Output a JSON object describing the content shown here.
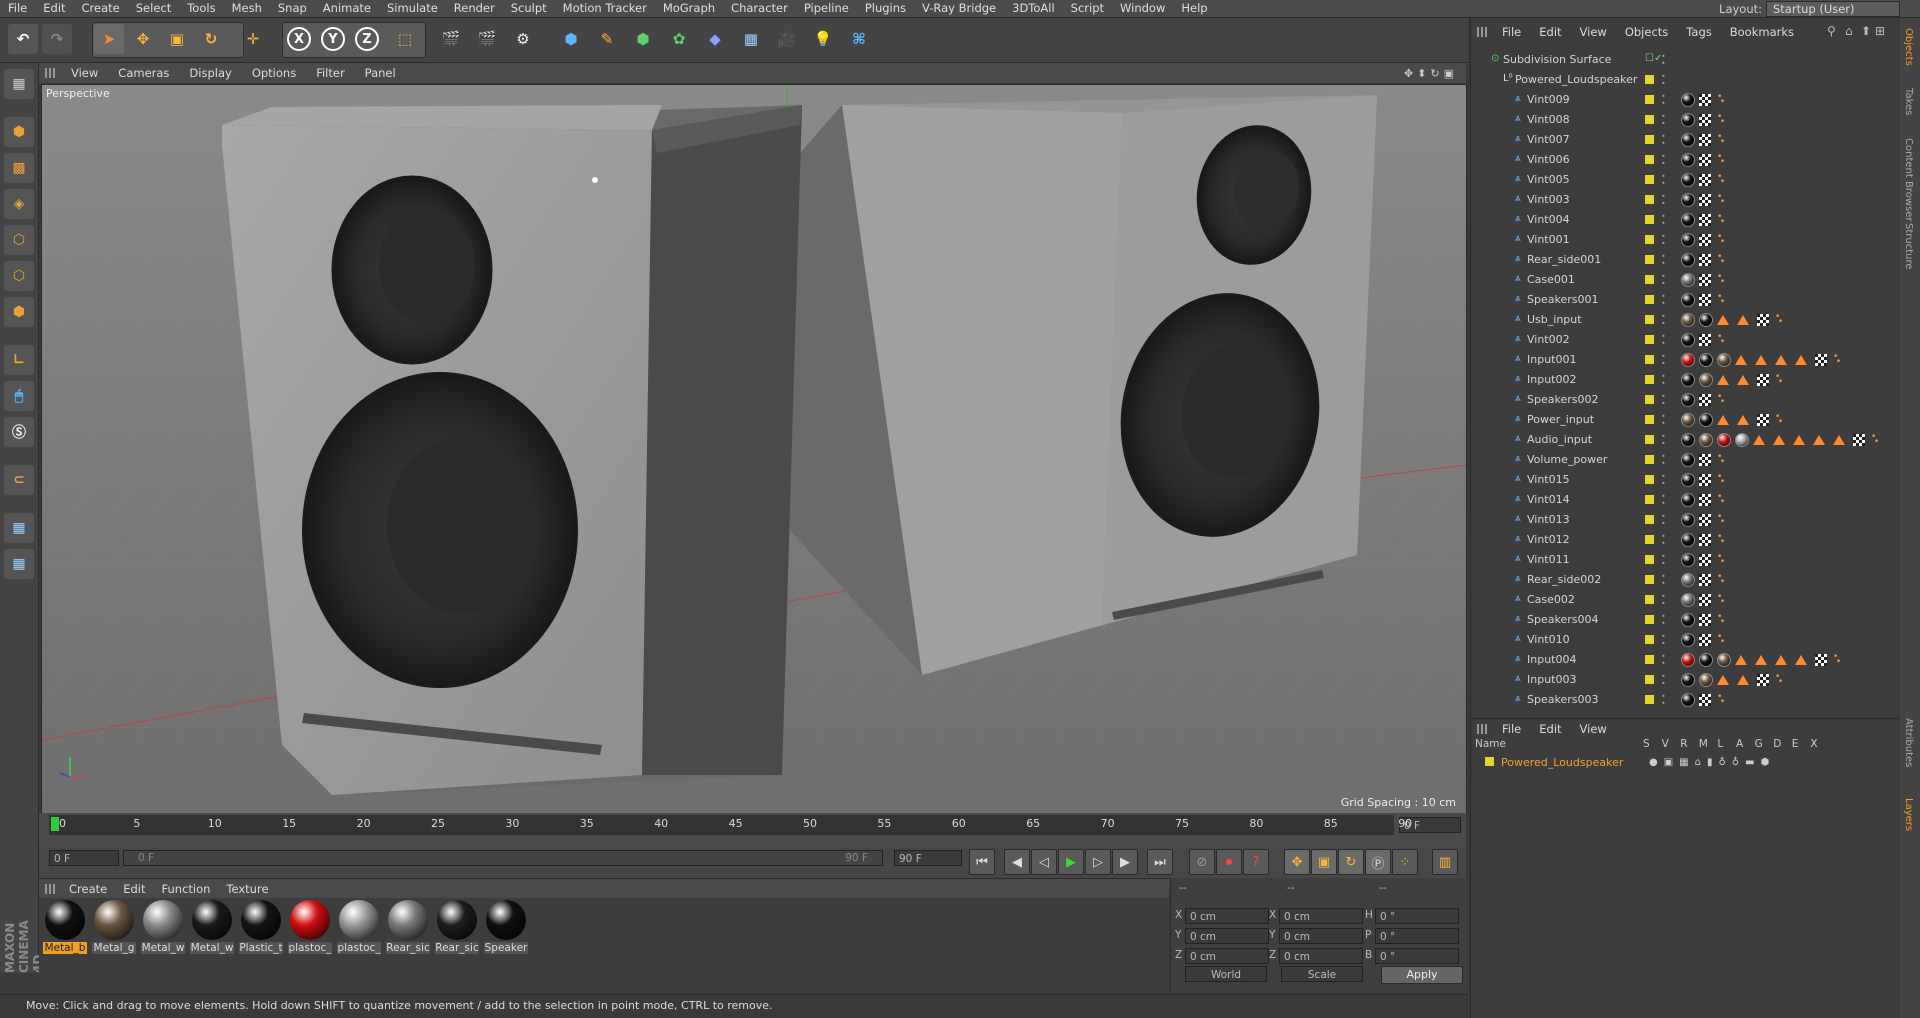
{
  "menu": [
    "File",
    "Edit",
    "Create",
    "Select",
    "Tools",
    "Mesh",
    "Snap",
    "Animate",
    "Simulate",
    "Render",
    "Sculpt",
    "Motion Tracker",
    "MoGraph",
    "Character",
    "Pipeline",
    "Plugins",
    "V-Ray Bridge",
    "3DToAll",
    "Script",
    "Window",
    "Help"
  ],
  "layout": {
    "label": "Layout:",
    "value": "Startup (User)"
  },
  "toolbar": {
    "x": "X",
    "y": "Y",
    "z": "Z"
  },
  "viewport": {
    "menu": [
      "View",
      "Cameras",
      "Display",
      "Options",
      "Filter",
      "Panel"
    ],
    "label": "Perspective",
    "grid_spacing": "Grid Spacing : 10 cm"
  },
  "timeline": {
    "ticks": [
      "0",
      "5",
      "10",
      "15",
      "20",
      "25",
      "30",
      "35",
      "40",
      "45",
      "50",
      "55",
      "60",
      "65",
      "70",
      "75",
      "80",
      "85",
      "90"
    ],
    "current_frame": "0 F",
    "start_frame": "0 F",
    "range_start": "0 F",
    "range_end": "90 F",
    "end_frame": "90 F"
  },
  "materials": {
    "menu": [
      "Create",
      "Edit",
      "Function",
      "Texture"
    ],
    "items": [
      {
        "label": "Metal_b",
        "color": "#111111",
        "selected": true
      },
      {
        "label": "Metal_g",
        "color": "#6b5640"
      },
      {
        "label": "Metal_w",
        "color": "#8a8a8a"
      },
      {
        "label": "Metal_w",
        "color": "#1a1a1a"
      },
      {
        "label": "Plastic_t",
        "color": "#141414"
      },
      {
        "label": "plastoc_",
        "color": "#d01010"
      },
      {
        "label": "plastoc_",
        "color": "#9a9a9a"
      },
      {
        "label": "Rear_sic",
        "color": "#7a7a7a"
      },
      {
        "label": "Rear_sic",
        "color": "#1e1e1e"
      },
      {
        "label": "Speaker",
        "color": "#101010"
      }
    ]
  },
  "coords": {
    "headers": [
      "--",
      "--",
      "--"
    ],
    "rows": [
      {
        "a": "X",
        "av": "0 cm",
        "b": "X",
        "bv": "0 cm",
        "c": "H",
        "cv": "0 °"
      },
      {
        "a": "Y",
        "av": "0 cm",
        "b": "Y",
        "bv": "0 cm",
        "c": "P",
        "cv": "0 °"
      },
      {
        "a": "Z",
        "av": "0 cm",
        "b": "Z",
        "bv": "0 cm",
        "c": "B",
        "cv": "0 °"
      }
    ],
    "world": "World",
    "scale": "Scale",
    "apply": "Apply"
  },
  "status": "Move: Click and drag to move elements. Hold down SHIFT to quantize movement / add to the selection in point mode, CTRL to remove.",
  "object_manager": {
    "menu": [
      "File",
      "Edit",
      "View",
      "Objects",
      "Tags",
      "Bookmarks"
    ],
    "root": "Subdivision Surface",
    "group": "Powered_Loudspeaker",
    "objects": [
      {
        "name": "Vint009",
        "tags": "std"
      },
      {
        "name": "Vint008",
        "tags": "std"
      },
      {
        "name": "Vint007",
        "tags": "std"
      },
      {
        "name": "Vint006",
        "tags": "std"
      },
      {
        "name": "Vint005",
        "tags": "std"
      },
      {
        "name": "Vint003",
        "tags": "std"
      },
      {
        "name": "Vint004",
        "tags": "std"
      },
      {
        "name": "Vint001",
        "tags": "std"
      },
      {
        "name": "Rear_side001",
        "tags": "std"
      },
      {
        "name": "Case001",
        "tags": "grey"
      },
      {
        "name": "Speakers001",
        "tags": "std"
      },
      {
        "name": "Usb_input",
        "tags": "usb"
      },
      {
        "name": "Vint002",
        "tags": "std"
      },
      {
        "name": "Input001",
        "tags": "input1"
      },
      {
        "name": "Input002",
        "tags": "input2"
      },
      {
        "name": "Speakers002",
        "tags": "std"
      },
      {
        "name": "Power_input",
        "tags": "usb"
      },
      {
        "name": "Audio_input",
        "tags": "audio"
      },
      {
        "name": "Volume_power",
        "tags": "std"
      },
      {
        "name": "Vint015",
        "tags": "std"
      },
      {
        "name": "Vint014",
        "tags": "std"
      },
      {
        "name": "Vint013",
        "tags": "std"
      },
      {
        "name": "Vint012",
        "tags": "std"
      },
      {
        "name": "Vint011",
        "tags": "std"
      },
      {
        "name": "Rear_side002",
        "tags": "grey"
      },
      {
        "name": "Case002",
        "tags": "grey"
      },
      {
        "name": "Speakers004",
        "tags": "std"
      },
      {
        "name": "Vint010",
        "tags": "std"
      },
      {
        "name": "Input004",
        "tags": "input1"
      },
      {
        "name": "Input003",
        "tags": "input2"
      },
      {
        "name": "Speakers003",
        "tags": "std"
      }
    ]
  },
  "layer_manager": {
    "menu": [
      "File",
      "Edit",
      "View"
    ],
    "columns": [
      "Name",
      "S",
      "V",
      "R",
      "M",
      "L",
      "A",
      "G",
      "D",
      "E",
      "X"
    ],
    "layer": "Powered_Loudspeaker"
  },
  "right_tabs": [
    "Objects",
    "Takes",
    "Content Browser",
    "Structure",
    "Attributes",
    "Layers"
  ],
  "brand": "MAXON CINEMA 4D"
}
